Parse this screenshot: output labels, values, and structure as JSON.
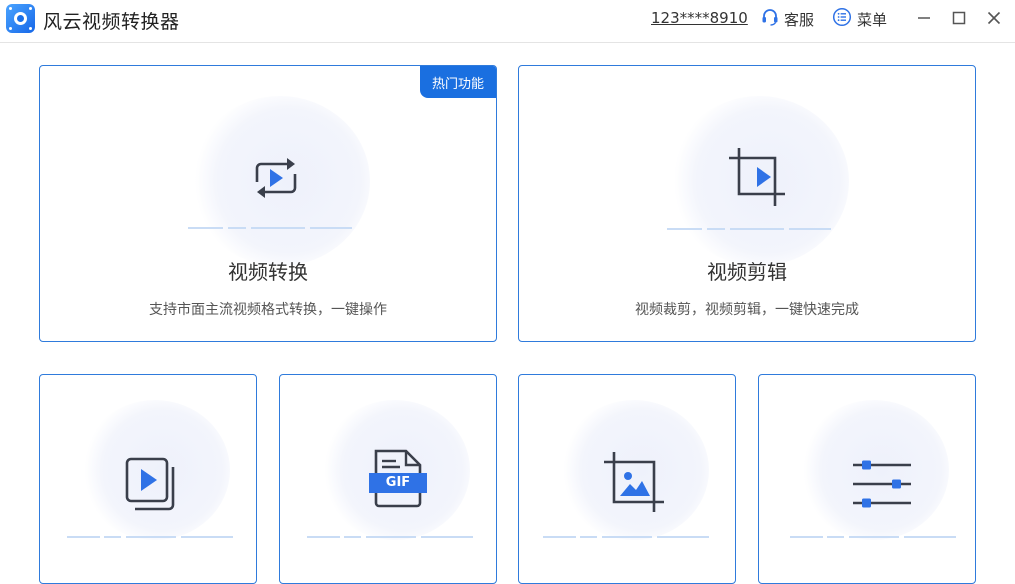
{
  "app": {
    "title": "风云视频转换器",
    "account": "123****8910",
    "service_label": "客服",
    "menu_label": "菜单"
  },
  "colors": {
    "accent": "#1a6fe0",
    "card_border": "#2f7bdc",
    "icon_dark": "#3a3f4b",
    "icon_blue": "#2f72e6"
  },
  "cards_top": [
    {
      "title": "视频转换",
      "desc": "支持市面主流视频格式转换，一键操作",
      "badge": "热门功能",
      "icon": "convert-icon"
    },
    {
      "title": "视频剪辑",
      "desc": "视频裁剪，视频剪辑，一键快速完成",
      "icon": "crop-video-icon"
    }
  ],
  "cards_bottom": [
    {
      "icon": "video-copy-icon"
    },
    {
      "icon": "gif-icon",
      "icon_text": "GIF"
    },
    {
      "icon": "crop-image-icon"
    },
    {
      "icon": "sliders-icon"
    }
  ]
}
